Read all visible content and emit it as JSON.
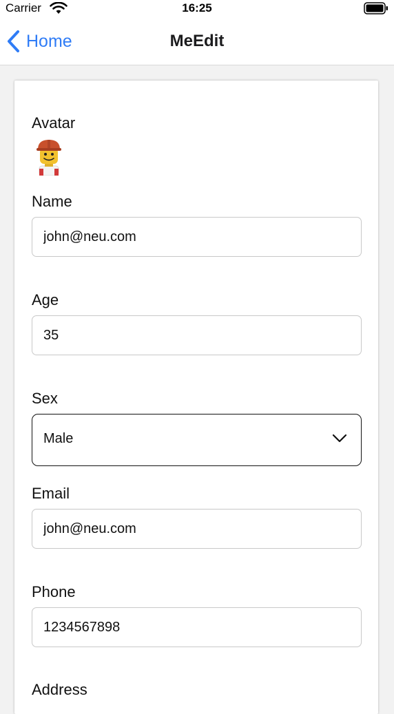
{
  "status_bar": {
    "carrier": "Carrier",
    "time": "16:25",
    "icons": [
      "wifi-icon",
      "battery-icon"
    ]
  },
  "nav": {
    "back_label": "Home",
    "title": "MeEdit",
    "accent_color": "#2f7cf6"
  },
  "form": {
    "avatar_label": "Avatar",
    "avatar_icon": "lego-worker-avatar",
    "name_label": "Name",
    "name_value": "john@neu.com",
    "age_label": "Age",
    "age_value": "35",
    "sex_label": "Sex",
    "sex_value": "Male",
    "email_label": "Email",
    "email_value": "john@neu.com",
    "phone_label": "Phone",
    "phone_value": "1234567898",
    "address_label": "Address"
  }
}
